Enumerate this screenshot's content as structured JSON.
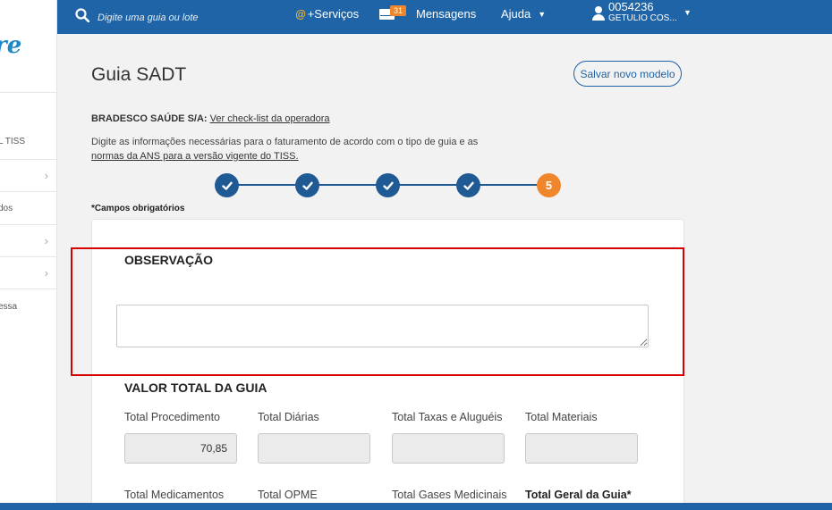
{
  "sidebar": {
    "logo_text": "re",
    "items": [
      {
        "label": "L TISS",
        "chevron": false
      },
      {
        "label": "",
        "chevron": true
      },
      {
        "label": "dos",
        "chevron": false
      },
      {
        "label": "",
        "chevron": true
      },
      {
        "label": "",
        "chevron": true
      },
      {
        "label": "essa",
        "chevron": false
      }
    ]
  },
  "topbar": {
    "search_placeholder": "Digite uma guia ou lote",
    "services_at": "@",
    "services_label": "+Serviços",
    "messages_count": "31",
    "messages_label": "Mensagens",
    "help_label": "Ajuda",
    "user_code": "0054236",
    "user_name": "GETULIO COS..."
  },
  "page": {
    "title": "Guia SADT",
    "save_model_label": "Salvar novo modelo",
    "operator_name": "BRADESCO SAÚDE S/A:",
    "operator_link": "Ver check-list da operadora",
    "info_text": "Digite as informações necessárias para o faturamento de acordo com o tipo de guia e as",
    "info_link": "normas da ANS para a versão vigente do TISS.",
    "required_note": "*Campos obrigatórios"
  },
  "stepper": {
    "steps": [
      "done",
      "done",
      "done",
      "done",
      "5"
    ],
    "active_label": "5",
    "active_color": "#f0862c",
    "done_color": "#1f5a95"
  },
  "observation": {
    "title": "OBSERVAÇÃO",
    "value": ""
  },
  "totals": {
    "title": "VALOR TOTAL DA GUIA",
    "row1": [
      {
        "label": "Total Procedimento",
        "value": "70,85"
      },
      {
        "label": "Total Diárias",
        "value": ""
      },
      {
        "label": "Total Taxas e Aluguéis",
        "value": ""
      },
      {
        "label": "Total Materiais",
        "value": ""
      }
    ],
    "row2": [
      {
        "label": "Total Medicamentos"
      },
      {
        "label": "Total OPME"
      },
      {
        "label": "Total Gases Medicinais"
      },
      {
        "label": "Total Geral da Guia*"
      }
    ]
  },
  "colors": {
    "brand_blue": "#1f64a6",
    "accent_orange": "#f0862c",
    "highlight_red": "#d60000"
  }
}
